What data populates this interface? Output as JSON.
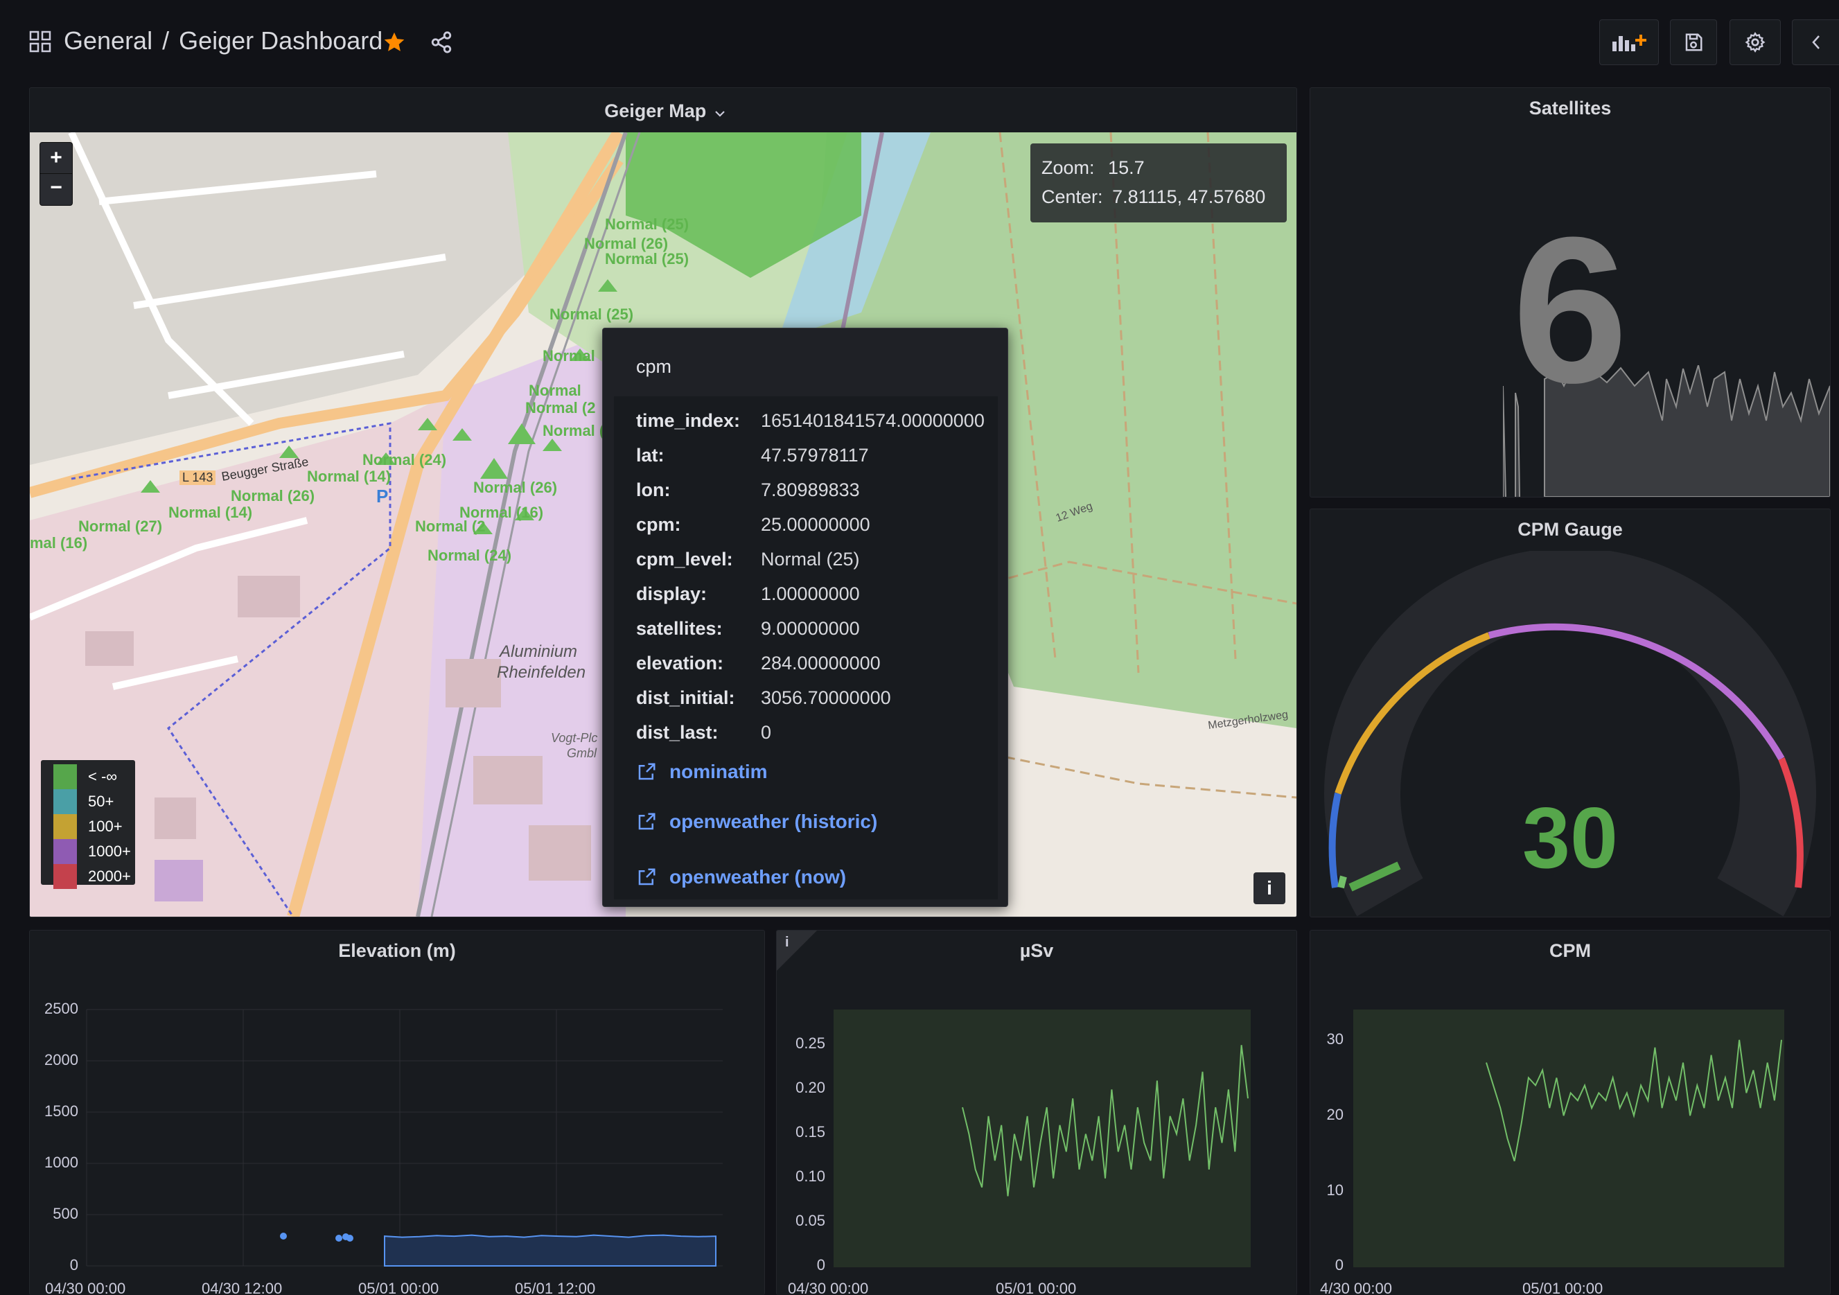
{
  "topbar": {
    "folder": "General",
    "separator": "/",
    "dashboard_title": "Geiger Dashboard"
  },
  "map_panel": {
    "title": "Geiger Map",
    "zoom_in": "+",
    "zoom_out": "−",
    "info_button": "i",
    "view_info": {
      "zoom_label": "Zoom:",
      "zoom_value": "15.7",
      "center_label": "Center:",
      "center_value": "7.81115, 47.57680"
    },
    "legend": [
      {
        "label": "< -∞",
        "color": "#56a64b"
      },
      {
        "label": "50+",
        "color": "#4a9fa6"
      },
      {
        "label": "100+",
        "color": "#c4a233"
      },
      {
        "label": "1000+",
        "color": "#8f5bb3"
      },
      {
        "label": "2000+",
        "color": "#c4414c"
      }
    ],
    "map_labels": {
      "street1": "L 143",
      "street2": "Beugger Straße",
      "place1": "Aluminium",
      "place2": "Rheinfelden",
      "place3": "Vogt-Plc",
      "place4": "Gmbl",
      "weg1": "12 Weg",
      "weg2": "Metzgerholzweg",
      "parking": "P"
    },
    "marker_labels": [
      "Normal (25)",
      "Normal (26)",
      "Normal (25)",
      "Normal (25)",
      "Normal",
      "Normal",
      "Normal (2",
      "Normal (18",
      "Normal (24)",
      "Normal (26)",
      "Normal (14)",
      "Normal (14)",
      "Normal (27)",
      "mal (16)",
      "Normal (26)",
      "Normal (16)",
      "Normal (2",
      "Normal (24)"
    ],
    "tooltip": {
      "tab": "cpm",
      "rows": [
        {
          "key": "time_index:",
          "value": "1651401841574.00000000"
        },
        {
          "key": "lat:",
          "value": "47.57978117"
        },
        {
          "key": "lon:",
          "value": "7.80989833"
        },
        {
          "key": "cpm:",
          "value": "25.00000000"
        },
        {
          "key": "cpm_level:",
          "value": "Normal (25)"
        },
        {
          "key": "display:",
          "value": "1.00000000"
        },
        {
          "key": "satellites:",
          "value": "9.00000000"
        },
        {
          "key": "elevation:",
          "value": "284.00000000"
        },
        {
          "key": "dist_initial:",
          "value": "3056.70000000"
        },
        {
          "key": "dist_last:",
          "value": "0"
        }
      ],
      "links": [
        "nominatim",
        "openweather (historic)",
        "openweather (now)"
      ]
    }
  },
  "satellites_panel": {
    "title": "Satellites",
    "value": "6"
  },
  "gauge_panel": {
    "title": "CPM Gauge",
    "value": "30",
    "min": 0,
    "max": 2500,
    "value_number": 30
  },
  "elevation_panel": {
    "title": "Elevation (m)",
    "y_ticks": [
      "2500",
      "2000",
      "1500",
      "1000",
      "500",
      "0"
    ],
    "x_ticks": [
      "04/30 00:00",
      "04/30 12:00",
      "05/01 00:00",
      "05/01 12:00"
    ]
  },
  "usv_panel": {
    "title": "µSv",
    "info": "i",
    "y_ticks": [
      "0.25",
      "0.20",
      "0.15",
      "0.10",
      "0.05",
      "0"
    ],
    "x_ticks": [
      "04/30 00:00",
      "05/01 00:00"
    ]
  },
  "cpm_panel": {
    "title": "CPM",
    "y_ticks": [
      "30",
      "20",
      "10",
      "0"
    ],
    "x_ticks": [
      "4/30 00:00",
      "05/01 00:00"
    ]
  },
  "colors": {
    "background": "#111217",
    "panel": "#181b1f",
    "series_green": "#73bf69",
    "series_blue": "#5794f2",
    "accent_orange": "#ff7a00",
    "link_blue": "#6e9fff"
  },
  "chart_data": [
    {
      "type": "area",
      "title": "Elevation (m)",
      "ylim": [
        0,
        2500
      ],
      "x_ticks": [
        "04/30 00:00",
        "04/30 12:00",
        "05/01 00:00",
        "05/01 12:00"
      ],
      "series": [
        {
          "values": [
            290,
            280,
            285,
            295,
            290,
            300,
            285,
            290,
            280,
            295,
            290,
            285,
            300,
            290,
            280,
            295,
            300,
            290,
            285,
            290
          ]
        }
      ]
    },
    {
      "type": "line",
      "title": "µSv",
      "ylim": [
        0,
        0.29
      ],
      "x_ticks": [
        "04/30 00:00",
        "05/01 00:00"
      ],
      "series": [
        {
          "values": [
            0.18,
            0.15,
            0.11,
            0.09,
            0.17,
            0.12,
            0.16,
            0.08,
            0.15,
            0.12,
            0.17,
            0.09,
            0.14,
            0.18,
            0.1,
            0.16,
            0.13,
            0.19,
            0.11,
            0.15,
            0.12,
            0.17,
            0.1,
            0.2,
            0.13,
            0.16,
            0.11,
            0.18,
            0.14,
            0.12,
            0.21,
            0.1,
            0.17,
            0.15,
            0.19,
            0.12,
            0.16,
            0.22,
            0.11,
            0.18,
            0.14,
            0.2,
            0.13,
            0.25,
            0.19
          ]
        }
      ]
    },
    {
      "type": "line",
      "title": "CPM",
      "ylim": [
        0,
        34
      ],
      "x_ticks": [
        "4/30 00:00",
        "05/01 00:00"
      ],
      "series": [
        {
          "values": [
            27,
            24,
            21,
            17,
            14,
            19,
            25,
            24,
            26,
            21,
            25,
            20,
            23,
            22,
            24,
            21,
            23,
            22,
            25,
            21,
            23,
            20,
            24,
            22,
            29,
            21,
            25,
            22,
            27,
            20,
            24,
            21,
            28,
            22,
            25,
            21,
            30,
            23,
            26,
            21,
            27,
            22,
            30
          ]
        }
      ]
    }
  ]
}
